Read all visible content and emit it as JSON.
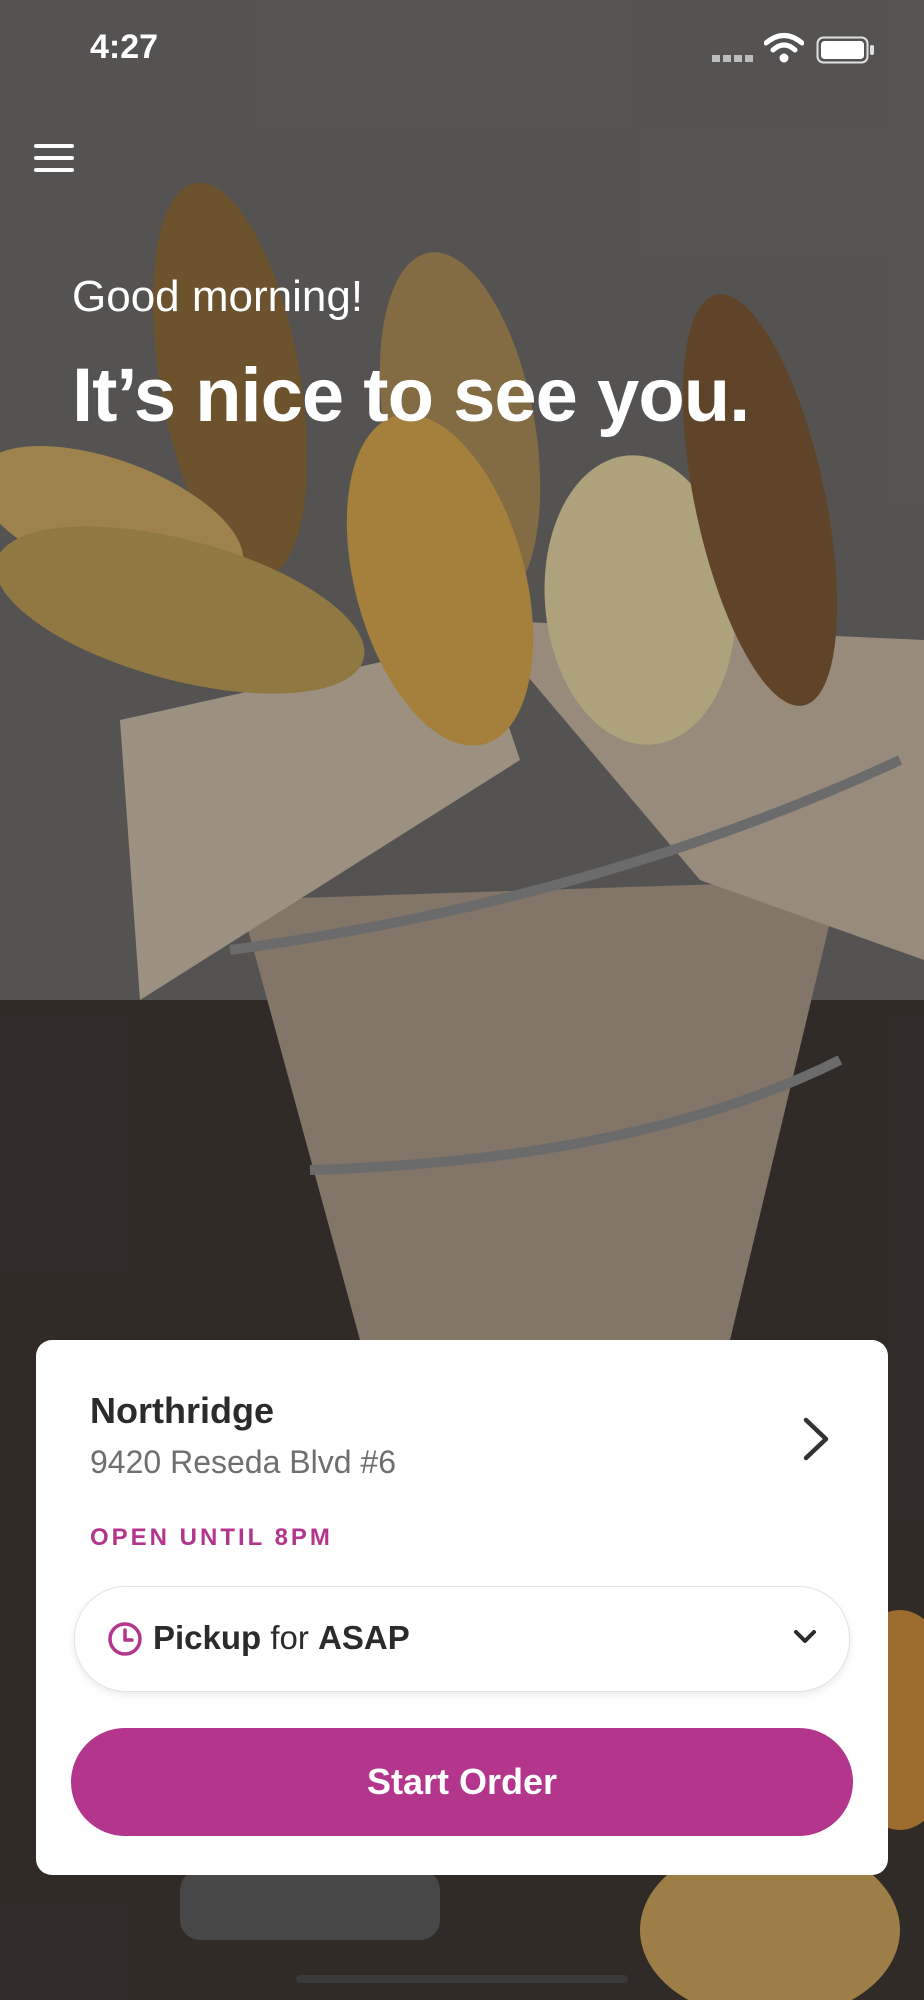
{
  "status_bar": {
    "time": "4:27"
  },
  "greeting": {
    "line1": "Good morning!",
    "line2": "It’s nice to see you."
  },
  "store_card": {
    "name": "Northridge",
    "address": "9420 Reseda Blvd #6",
    "status": "OPEN UNTIL 8PM",
    "pickup": {
      "mode": "Pickup",
      "joiner": "for",
      "time": "ASAP"
    },
    "start_button_label": "Start Order"
  },
  "icons": [
    "menu-icon",
    "chevron-right-icon",
    "clock-icon",
    "chevron-down-icon",
    "wifi-icon",
    "battery-icon"
  ],
  "colors": {
    "accent": "#b3368c"
  }
}
